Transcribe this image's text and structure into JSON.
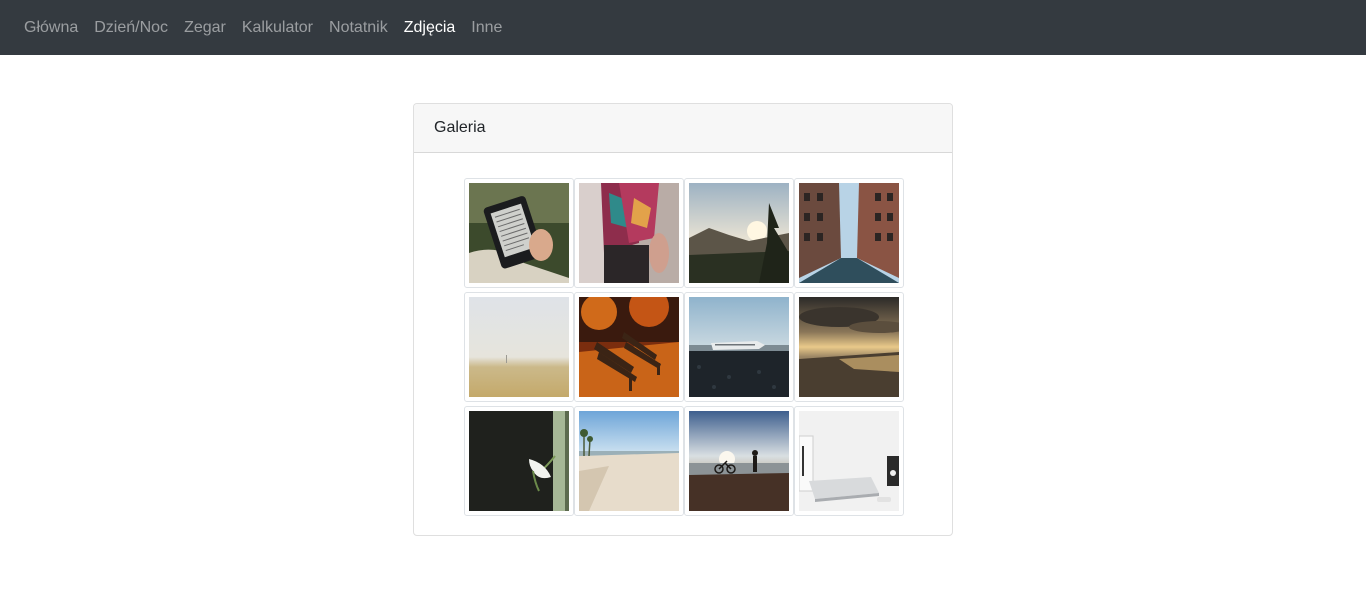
{
  "nav": {
    "items": [
      {
        "label": "Główna",
        "active": false
      },
      {
        "label": "Dzień/Noc",
        "active": false
      },
      {
        "label": "Zegar",
        "active": false
      },
      {
        "label": "Kalkulator",
        "active": false
      },
      {
        "label": "Notatnik",
        "active": false
      },
      {
        "label": "Zdjęcia",
        "active": true
      },
      {
        "label": "Inne",
        "active": false
      }
    ]
  },
  "gallery": {
    "title": "Galeria",
    "photos": [
      {
        "subject": "e-reader-in-hands"
      },
      {
        "subject": "colorful-scarf-outfit"
      },
      {
        "subject": "mountain-forest-sunrise"
      },
      {
        "subject": "city-street-buildings"
      },
      {
        "subject": "foggy-field"
      },
      {
        "subject": "autumn-park-bench"
      },
      {
        "subject": "plane-wreck-beach"
      },
      {
        "subject": "sunset-beach-clouds"
      },
      {
        "subject": "white-calla-lily"
      },
      {
        "subject": "sandy-beach-palms"
      },
      {
        "subject": "person-with-bike-at-sea"
      },
      {
        "subject": "laptop-on-white-desk"
      }
    ]
  }
}
